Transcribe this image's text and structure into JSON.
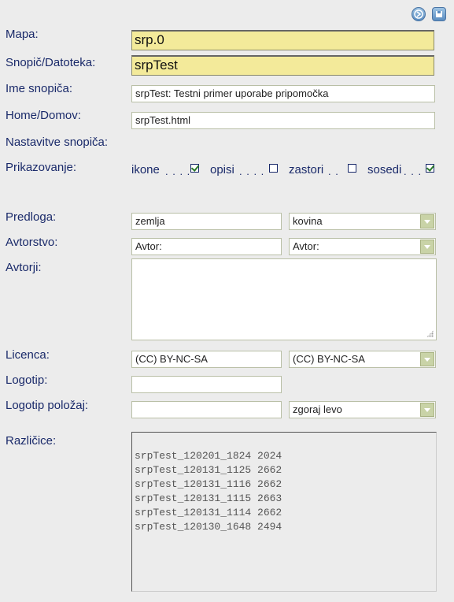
{
  "toolbar": {
    "icon1": "arrow-right-circle-icon",
    "icon2": "save-icon"
  },
  "labels": {
    "mapa": "Mapa:",
    "snopic": "Snopič/Datoteka:",
    "ime": "Ime snopiča:",
    "home": "Home/Domov:",
    "nastavitve": "Nastavitve snopiča:",
    "prikazovanje": "Prikazovanje:",
    "predloga": "Predloga:",
    "avtorstvo": "Avtorstvo:",
    "avtorji": "Avtorji:",
    "licenca": "Licenca:",
    "logotip": "Logotip:",
    "logotip_polozaj": "Logotip položaj:",
    "razlicice": "Različice:"
  },
  "fields": {
    "mapa": "srp.0",
    "snopic": "srpTest",
    "ime": "srpTest: Testni primer uporabe pripomočka",
    "home": "srpTest.html",
    "predloga_input": "zemlja",
    "predloga_select": "kovina",
    "avtorstvo_input": "Avtor:",
    "avtorstvo_select": "Avtor:",
    "avtorji": "",
    "licenca_input": "(CC) BY-NC-SA",
    "licenca_select": "(CC) BY-NC-SA",
    "logotip": "",
    "logotip_polozaj_input": "",
    "logotip_polozaj_select": "zgoraj levo"
  },
  "display": {
    "ikone": "ikone",
    "ikone_dots": ". . . .",
    "ikone_checked": true,
    "opisi": "opisi",
    "opisi_dots": ". . . .",
    "opisi_checked": false,
    "zastori": "zastori",
    "zastori_dots": ". .",
    "zastori_checked": false,
    "sosedi": "sosedi",
    "sosedi_dots": ". . .",
    "sosedi_checked": true
  },
  "versions": [
    "srpTest_120201_1824 2024",
    "srpTest_120131_1125 2662",
    "srpTest_120131_1116 2662",
    "srpTest_120131_1115 2663",
    "srpTest_120131_1114 2662",
    "srpTest_120130_1648 2494"
  ]
}
